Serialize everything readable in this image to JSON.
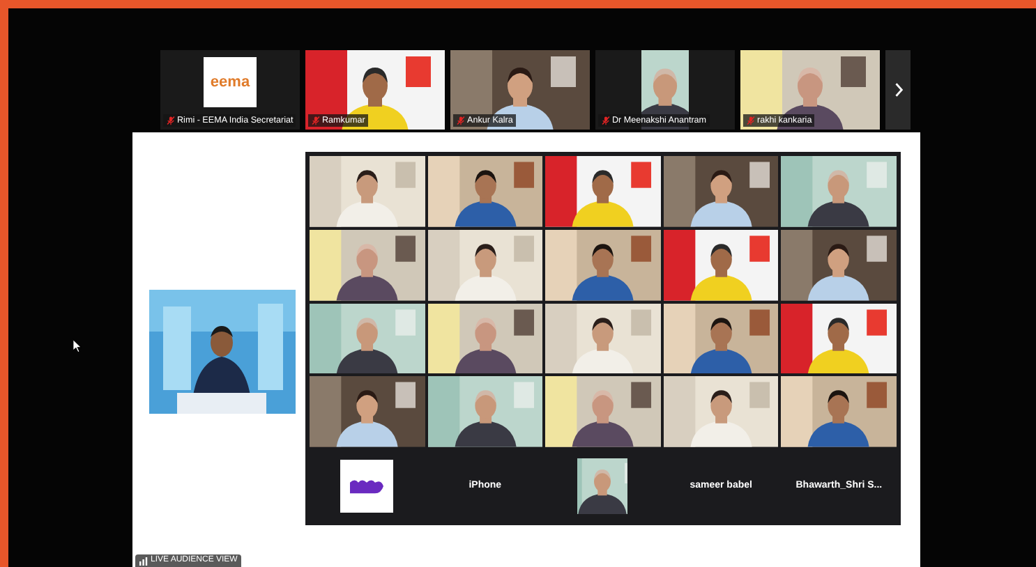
{
  "top_strip": {
    "participants": [
      {
        "kind": "logo",
        "logo_text": "eema",
        "name": "Rimi - EEMA India Secretariat",
        "muted": true
      },
      {
        "kind": "video",
        "name": "Ramkumar",
        "muted": true
      },
      {
        "kind": "video",
        "name": "Ankur Kalra",
        "muted": true
      },
      {
        "kind": "inset_video",
        "name": "Dr Meenakshi Anantram",
        "muted": true
      },
      {
        "kind": "video",
        "name": "rakhi kankaria",
        "muted": true
      }
    ]
  },
  "shared_screen": {
    "grid": [
      {
        "kind": "video"
      },
      {
        "kind": "video"
      },
      {
        "kind": "video"
      },
      {
        "kind": "video"
      },
      {
        "kind": "video"
      },
      {
        "kind": "video"
      },
      {
        "kind": "video"
      },
      {
        "kind": "video"
      },
      {
        "kind": "video"
      },
      {
        "kind": "video"
      },
      {
        "kind": "video"
      },
      {
        "kind": "video"
      },
      {
        "kind": "video"
      },
      {
        "kind": "video"
      },
      {
        "kind": "video"
      },
      {
        "kind": "video"
      },
      {
        "kind": "video"
      },
      {
        "kind": "video"
      },
      {
        "kind": "video"
      },
      {
        "kind": "video"
      },
      {
        "kind": "logo"
      },
      {
        "kind": "name",
        "label": "iPhone"
      },
      {
        "kind": "inset_video"
      },
      {
        "kind": "name",
        "label": "sameer babel"
      },
      {
        "kind": "name",
        "label": "Bhawarth_Shri S..."
      }
    ],
    "badge": "LIVE AUDIENCE VIEW"
  }
}
